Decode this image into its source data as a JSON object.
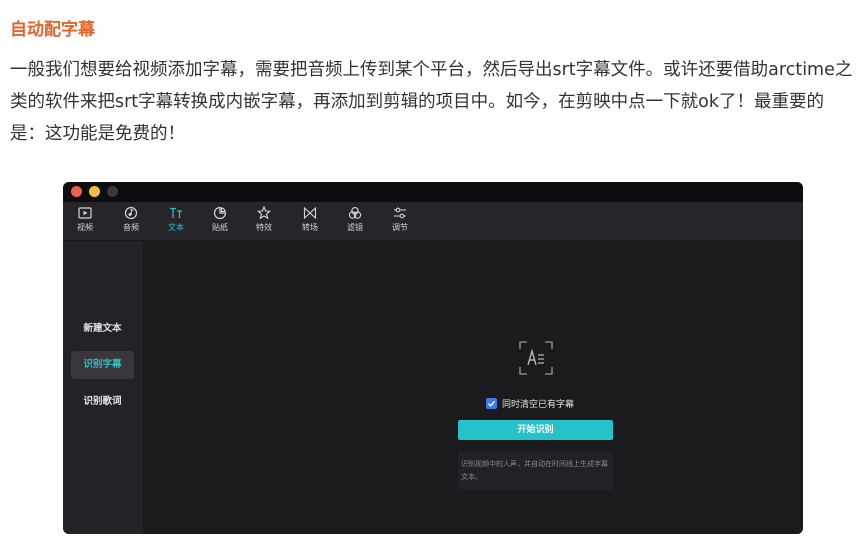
{
  "article": {
    "title": "自动配字幕",
    "body": "一般我们想要给视频添加字幕，需要把音频上传到某个平台，然后导出srt字幕文件。或许还要借助arctime之类的软件来把srt字幕转换成内嵌字幕，再添加到剪辑的项目中。如今，在剪映中点一下就ok了！最重要的是：这功能是免费的！"
  },
  "app": {
    "toolbar": [
      {
        "label": "视频",
        "icon": "video-icon"
      },
      {
        "label": "音频",
        "icon": "audio-icon"
      },
      {
        "label": "文本",
        "icon": "text-icon",
        "active": true
      },
      {
        "label": "贴纸",
        "icon": "sticker-icon"
      },
      {
        "label": "特效",
        "icon": "effects-icon"
      },
      {
        "label": "转场",
        "icon": "transition-icon"
      },
      {
        "label": "滤镜",
        "icon": "filter-icon"
      },
      {
        "label": "调节",
        "icon": "adjust-icon"
      }
    ],
    "sidebar": [
      {
        "label": "新建文本"
      },
      {
        "label": "识别字幕",
        "active": true
      },
      {
        "label": "识别歌词"
      }
    ],
    "panel": {
      "checkbox_label": "同时清空已有字幕",
      "checkbox_checked": true,
      "start_button": "开始识别",
      "hint": "识别视频中的人声，并自动在时间线上生成字幕文本。"
    },
    "colors": {
      "accent": "#26c2c9",
      "checkbox": "#3b7cf0",
      "title_orange": "#e8622a"
    }
  }
}
